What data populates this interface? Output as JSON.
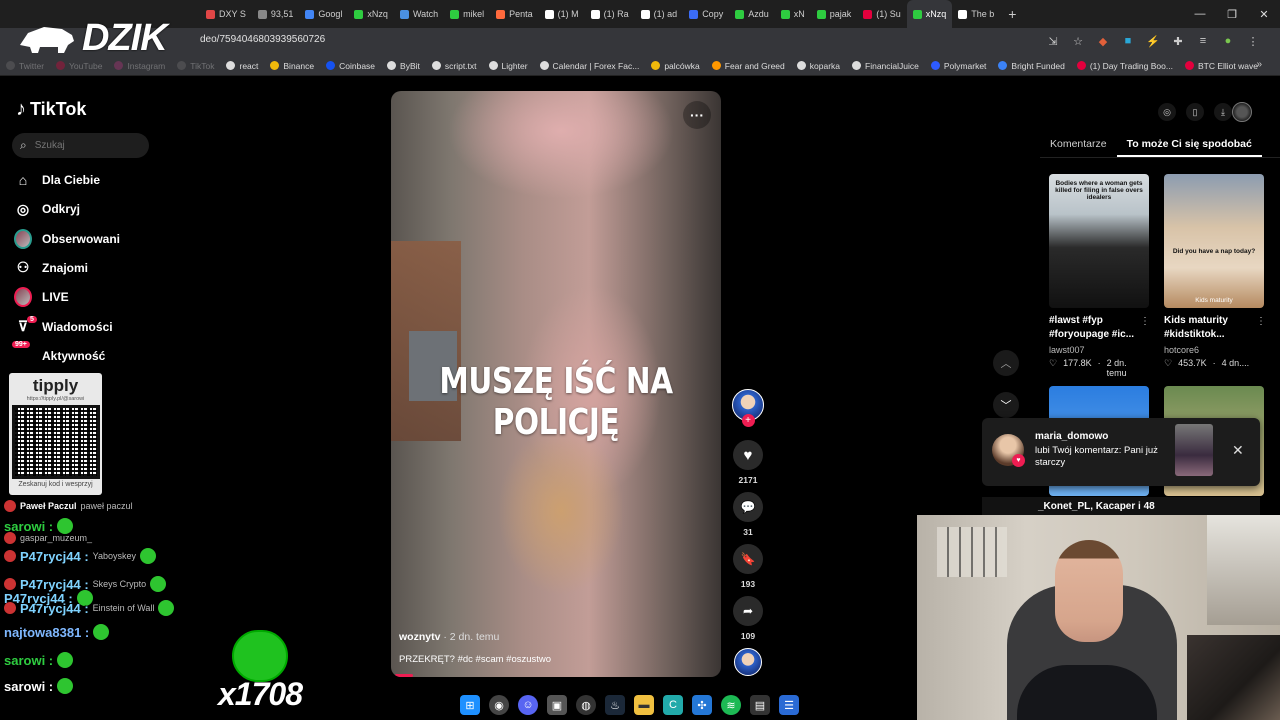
{
  "browser": {
    "tabs": [
      {
        "label": "DXY S",
        "color": "#e04646"
      },
      {
        "label": "93,51",
        "color": "#888888"
      },
      {
        "label": "Googl",
        "color": "#4285f4"
      },
      {
        "label": "xNzq",
        "color": "#2ecc40"
      },
      {
        "label": "Watch",
        "color": "#4a90e2"
      },
      {
        "label": "mikel",
        "color": "#2ecc40"
      },
      {
        "label": "Penta",
        "color": "#ff6a3d"
      },
      {
        "label": "(1) M",
        "color": "#ffffff"
      },
      {
        "label": "(1) Ra",
        "color": "#ffffff"
      },
      {
        "label": "(1) ad",
        "color": "#ffffff"
      },
      {
        "label": "Copy",
        "color": "#3b6cf6"
      },
      {
        "label": "Azdu",
        "color": "#2ecc40"
      },
      {
        "label": "xN",
        "color": "#2ecc40"
      },
      {
        "label": "pajak",
        "color": "#2ecc40"
      },
      {
        "label": "(1) Su",
        "color": "#e3003d"
      },
      {
        "label": "xNzq",
        "color": "#2ecc40"
      },
      {
        "label": "The b",
        "color": "#ffffff"
      }
    ],
    "url": "deo/7594046803939560726",
    "bookmarks": [
      {
        "label": "Twitter",
        "color": "#777777"
      },
      {
        "label": "YouTube",
        "color": "#e3003d"
      },
      {
        "label": "Instagram",
        "color": "#c13584"
      },
      {
        "label": "TikTok",
        "color": "#777777"
      },
      {
        "label": "react",
        "color": "#dddddd"
      },
      {
        "label": "Binance",
        "color": "#f0b90b"
      },
      {
        "label": "Coinbase",
        "color": "#1652f0"
      },
      {
        "label": "ByBit",
        "color": "#dddddd"
      },
      {
        "label": "script.txt",
        "color": "#dddddd"
      },
      {
        "label": "Lighter",
        "color": "#dddddd"
      },
      {
        "label": "Calendar | Forex Fac...",
        "color": "#dddddd"
      },
      {
        "label": "palcówka",
        "color": "#f0b90b"
      },
      {
        "label": "Fear and Greed",
        "color": "#ff9800"
      },
      {
        "label": "koparka",
        "color": "#dddddd"
      },
      {
        "label": "FinancialJuice",
        "color": "#dddddd"
      },
      {
        "label": "Polymarket",
        "color": "#2d5bff"
      },
      {
        "label": "Bright Funded",
        "color": "#3b82f6"
      },
      {
        "label": "(1) Day Trading Boo...",
        "color": "#e3003d"
      },
      {
        "label": "BTC Elliot wave",
        "color": "#e3003d"
      }
    ]
  },
  "overlay": {
    "logo": "DZIK",
    "tipply_title": "tipply",
    "tipply_url": "https://tipply.pl/@sarowi",
    "tipply_footer": "Zeskanuj kod i wesprzyj",
    "combo": "x1708",
    "chat": [
      {
        "name": "Paweł Paczul",
        "faint": "paweł paczul",
        "color": "#ffffff"
      },
      {
        "name": "sarowi :",
        "faint": "",
        "color": "#2ecc40"
      },
      {
        "name": "",
        "faint": "gaspar_muzeum_",
        "color": "#ffffff"
      },
      {
        "name": "P47rycj44 :",
        "faint": "Yaboyskey",
        "color": "#7fd3ff"
      },
      {
        "name": "P47rycj44 :",
        "faint": "Skeys Crypto",
        "color": "#7fd3ff"
      },
      {
        "name": "P47rycj44 :",
        "faint": "",
        "color": "#7fd3ff"
      },
      {
        "name": "P47rycj44 :",
        "faint": "Einstein of Wall",
        "color": "#7fd3ff"
      },
      {
        "name": "najtowa8381 :",
        "faint": "",
        "color": "#7fb8ff"
      },
      {
        "name": "sarowi :",
        "faint": "",
        "color": "#2ecc40"
      },
      {
        "name": "sarowi :",
        "faint": "",
        "color": "#ffffff"
      }
    ]
  },
  "tiktok": {
    "logo": "TikTok",
    "search_placeholder": "Szukaj",
    "nav": [
      {
        "label": "Dla Ciebie",
        "icon": "home-icon"
      },
      {
        "label": "Odkryj",
        "icon": "compass-icon"
      },
      {
        "label": "Obserwowani",
        "icon": "following-avatar-icon"
      },
      {
        "label": "Znajomi",
        "icon": "friends-icon"
      },
      {
        "label": "LIVE",
        "icon": "live-icon"
      },
      {
        "label": "Wiadomości",
        "icon": "messages-icon"
      },
      {
        "label": "Aktywność",
        "icon": "activity-icon"
      }
    ],
    "messages_badge": "5",
    "activity_badge": "99+",
    "video": {
      "overlay_text": "MUSZĘ IŚĆ NA POLICJĘ",
      "author": "woznytv",
      "time": " · 2 dn. temu",
      "description": "PRZEKRĘT? #dc  #scam #oszustwo",
      "likes": "2171",
      "comments": "31",
      "saves": "193",
      "shares": "109"
    },
    "right_tabs": [
      "Komentarze",
      "To może Ci się spodobać"
    ],
    "recommendations": [
      {
        "thumb_text": "Bodies where a woman gets killed for filing in false overs idealers",
        "thumb_bottom": "",
        "title": "#lawst #fyp #foryoupage #ic...",
        "author": "lawst007",
        "likes": "177.8K",
        "date": "2 dn. temu"
      },
      {
        "thumb_text": "Did you have a nap today?",
        "thumb_bottom": "Kids maturity",
        "title": "Kids maturity #kidstiktok...",
        "author": "hotcore6",
        "likes": "453.7K",
        "date": "4 dn...."
      }
    ],
    "notification": {
      "user": "maria_domowo",
      "text": "lubi Twój komentarz: Pani już starczy"
    },
    "below_notification": "_Konet_PL, Kacaper i 48"
  },
  "colors": {
    "accent": "#ee1d52"
  }
}
